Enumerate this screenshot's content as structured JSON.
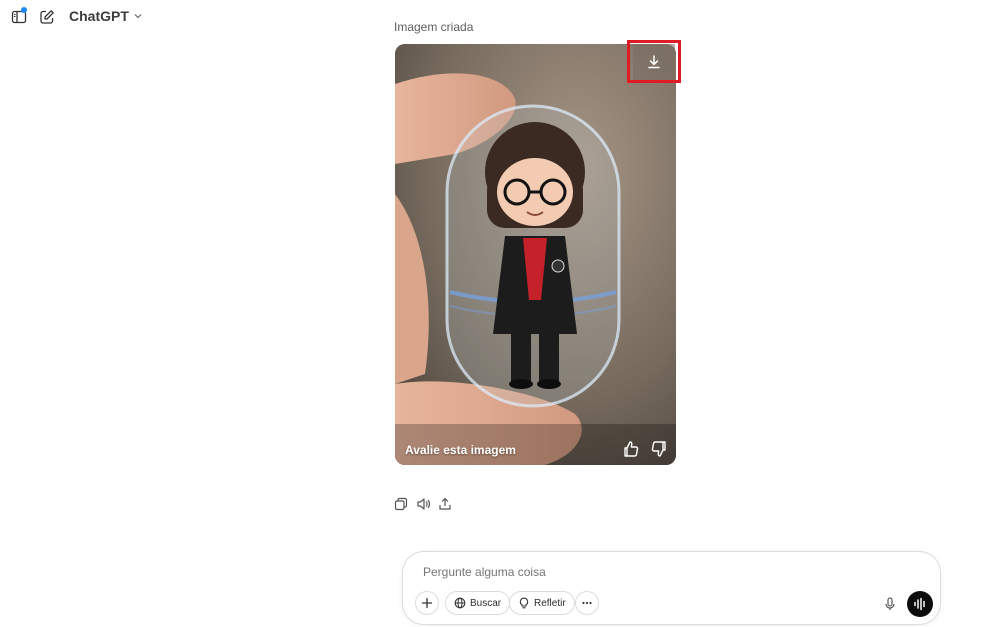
{
  "header": {
    "title": "ChatGPT"
  },
  "message": {
    "caption": "Imagem criada",
    "image": {
      "rate_label": "Avalie esta imagem"
    }
  },
  "composer": {
    "placeholder": "Pergunte alguma coisa",
    "buttons": {
      "search": "Buscar",
      "reason": "Refletir"
    }
  },
  "colors": {
    "highlight": "#e01b24",
    "badge": "#1e88ff"
  }
}
